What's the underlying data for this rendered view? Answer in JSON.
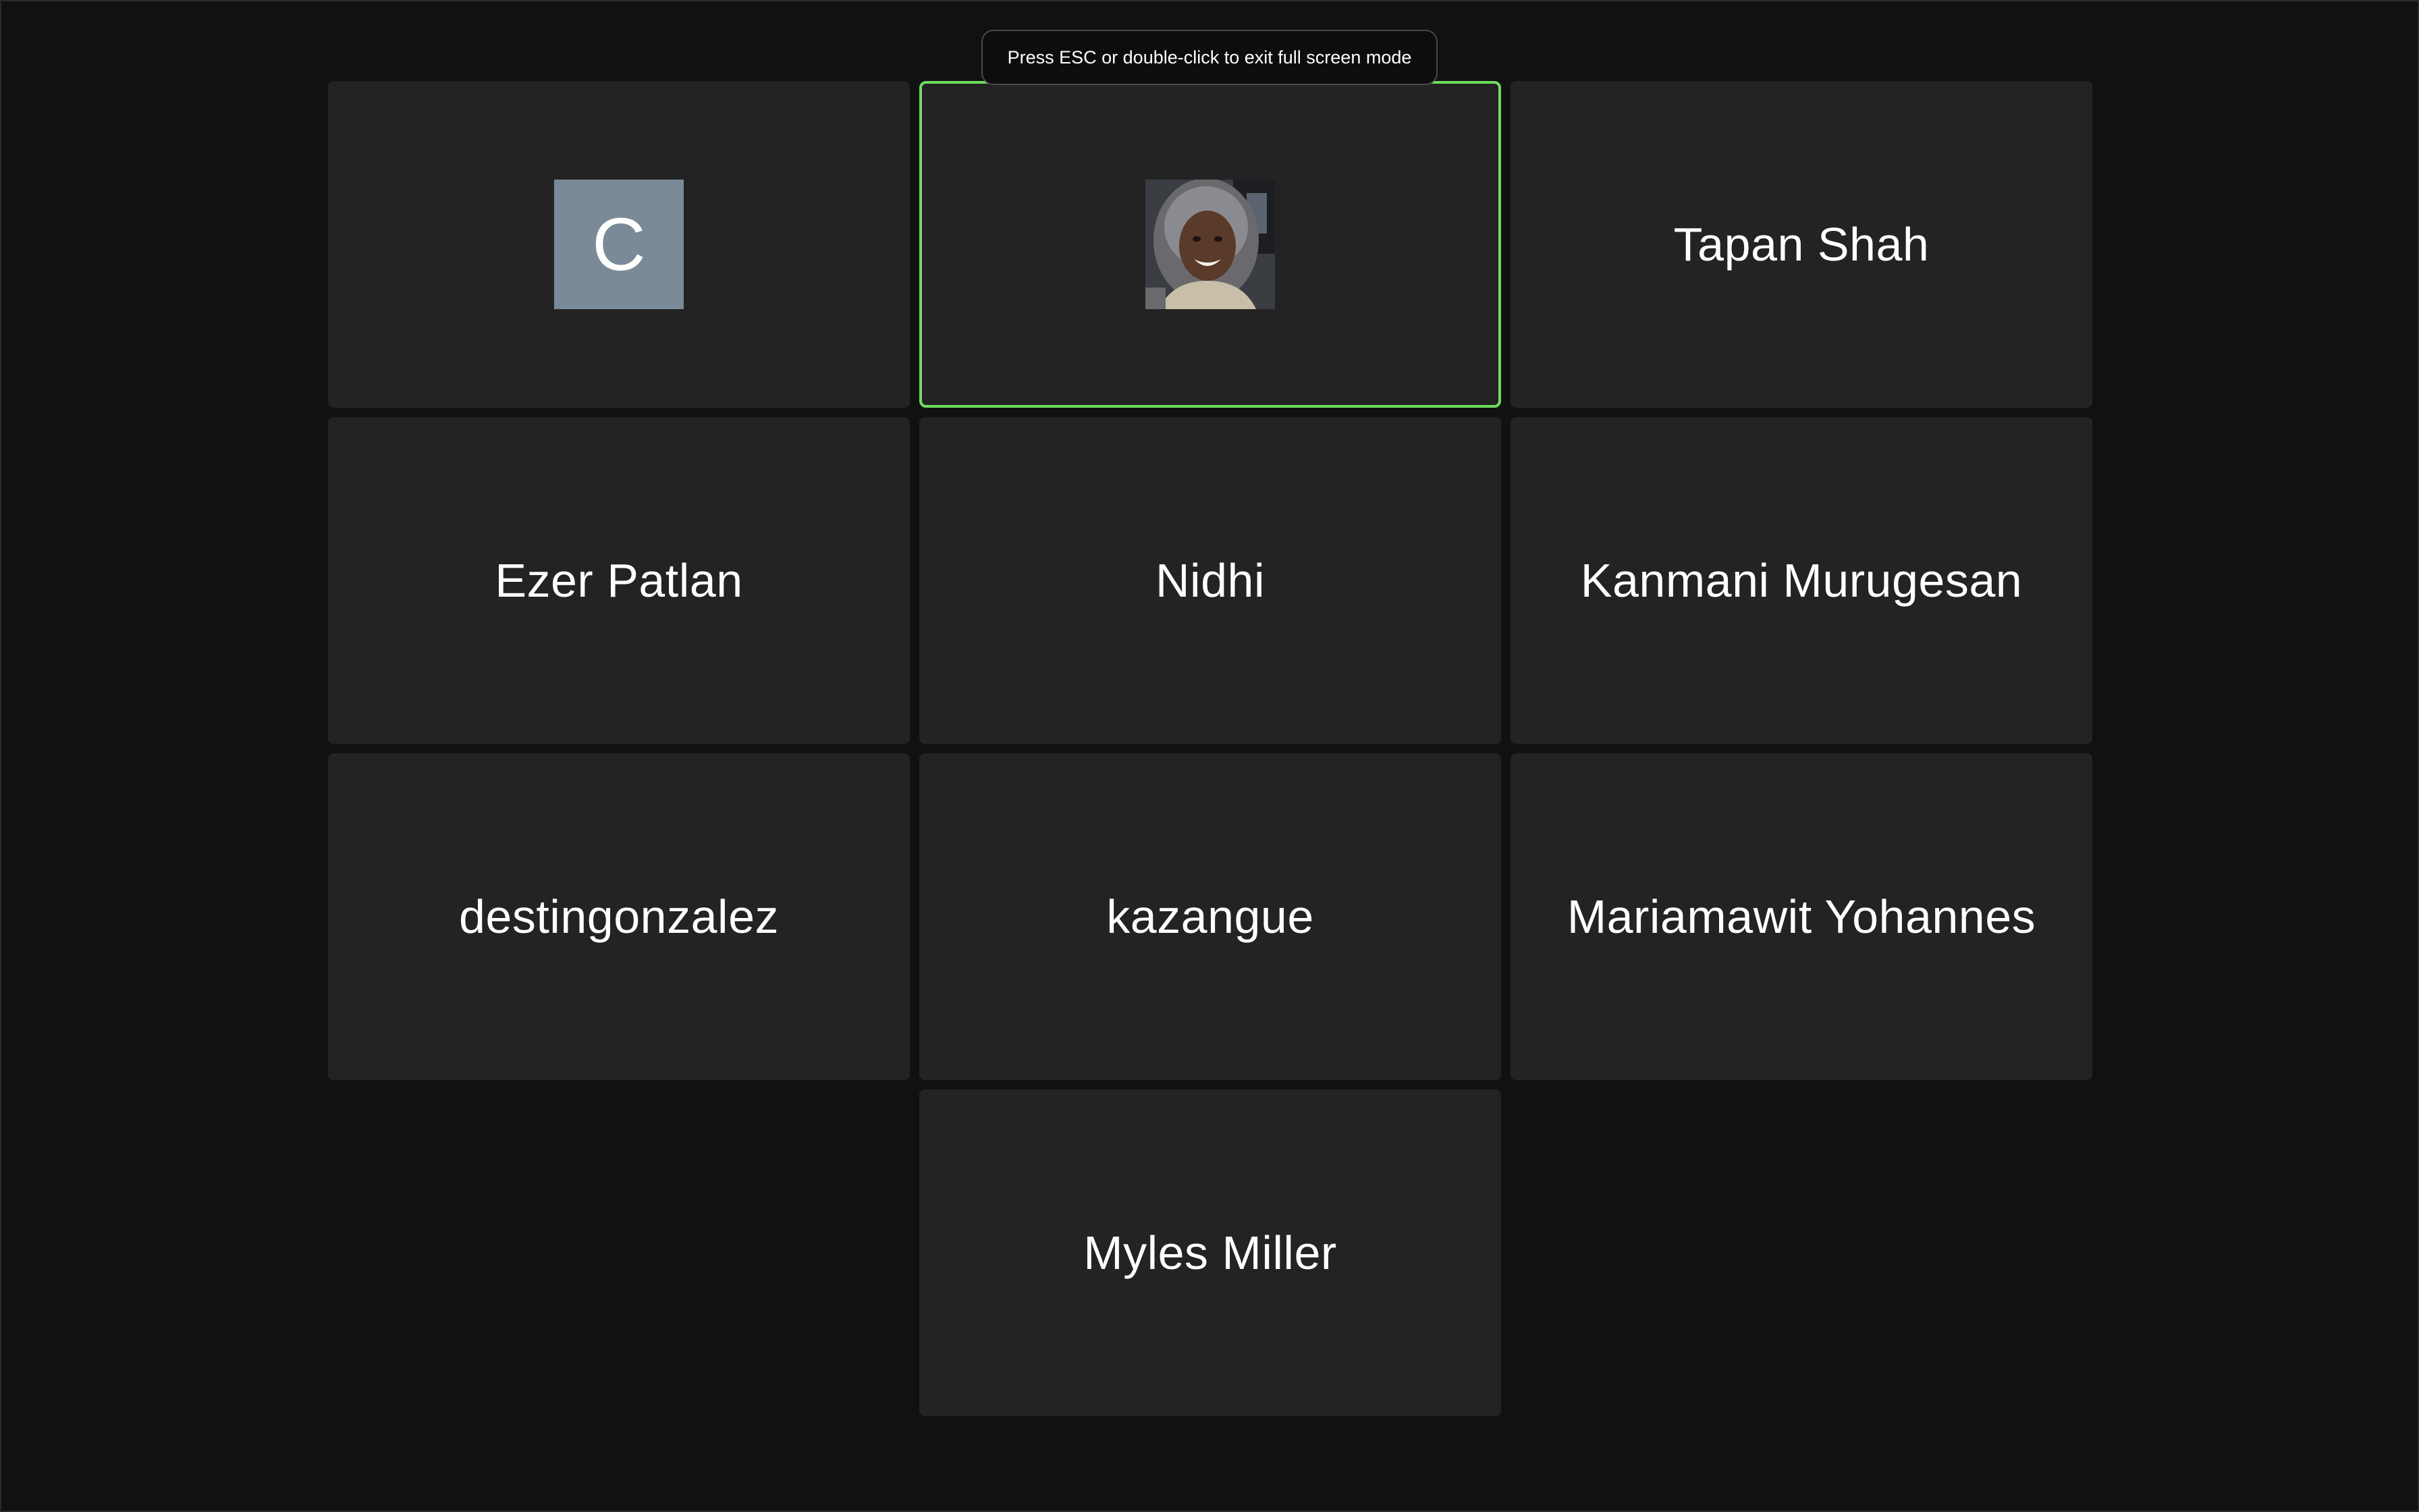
{
  "toast": {
    "text": "Press ESC or double-click to exit full screen mode"
  },
  "colors": {
    "background": "#111111",
    "tile": "#232323",
    "active_speaker_border": "#6fdc5f",
    "avatar_letter_bg": "#7a8a98"
  },
  "participants": [
    {
      "id": "c",
      "display": "avatar-letter",
      "avatar_letter": "C"
    },
    {
      "id": "photo-user",
      "display": "avatar-photo",
      "active_speaker": true
    },
    {
      "id": "tapan",
      "display": "name",
      "name": "Tapan Shah"
    },
    {
      "id": "ezer",
      "display": "name",
      "name": "Ezer Patlan"
    },
    {
      "id": "nidhi",
      "display": "name",
      "name": "Nidhi"
    },
    {
      "id": "kanmani",
      "display": "name",
      "name": "Kanmani Murugesan"
    },
    {
      "id": "destin",
      "display": "name",
      "name": "destingonzalez"
    },
    {
      "id": "kazangue",
      "display": "name",
      "name": "kazangue"
    },
    {
      "id": "mariamawit",
      "display": "name",
      "name": "Mariamawit Yohannes"
    },
    {
      "id": "myles",
      "display": "name",
      "name": "Myles Miller"
    }
  ]
}
